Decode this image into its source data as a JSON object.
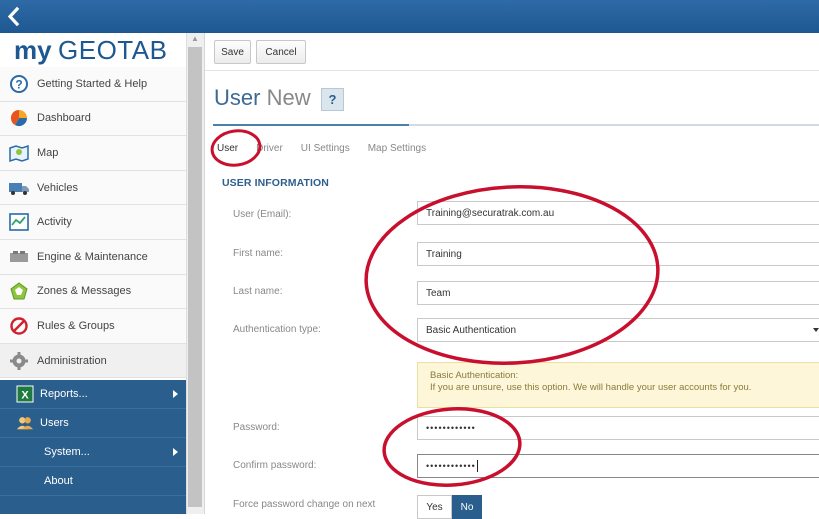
{
  "app": {
    "logo_prefix": "my",
    "logo_suffix": "GEOTAB"
  },
  "topbar": {
    "back_icon": "chevron-left-icon"
  },
  "sidebar": {
    "items": [
      {
        "label": "Getting Started & Help",
        "icon": "help-circle-icon"
      },
      {
        "label": "Dashboard",
        "icon": "pie-chart-icon"
      },
      {
        "label": "Map",
        "icon": "map-icon"
      },
      {
        "label": "Vehicles",
        "icon": "truck-icon"
      },
      {
        "label": "Activity",
        "icon": "activity-chart-icon"
      },
      {
        "label": "Engine & Maintenance",
        "icon": "engine-icon"
      },
      {
        "label": "Zones & Messages",
        "icon": "zone-icon"
      },
      {
        "label": "Rules & Groups",
        "icon": "prohibited-icon"
      },
      {
        "label": "Administration",
        "icon": "gear-icon"
      }
    ],
    "admin_sub": [
      {
        "label": "Reports...",
        "icon": "excel-icon"
      },
      {
        "label": "Users",
        "icon": "users-icon"
      },
      {
        "label": "System..."
      },
      {
        "label": "About"
      }
    ]
  },
  "toolbar": {
    "save_label": "Save",
    "cancel_label": "Cancel"
  },
  "page": {
    "title_main": "User",
    "title_muted": "New",
    "help_label": "?"
  },
  "tabs": [
    "User",
    "Driver",
    "UI Settings",
    "Map Settings"
  ],
  "section": {
    "heading": "USER INFORMATION"
  },
  "form": {
    "email_label": "User (Email):",
    "email_value": "Training@securatrak.com.au",
    "first_label": "First name:",
    "first_value": "Training",
    "last_label": "Last name:",
    "last_value": "Team",
    "auth_label": "Authentication type:",
    "auth_value": "Basic Authentication",
    "info_title": "Basic Authentication:",
    "info_text": "If you are unsure, use this option. We will handle your user accounts for you.",
    "password_label": "Password:",
    "password_value": "••••••••••••",
    "confirm_label": "Confirm password:",
    "confirm_value": "••••••••••••",
    "force_label": "Force password change on next",
    "force_yes": "Yes",
    "force_no": "No"
  },
  "colors": {
    "annotation": "#c8102e",
    "primary": "#2a5e8c",
    "topbar": "#2566a0"
  }
}
